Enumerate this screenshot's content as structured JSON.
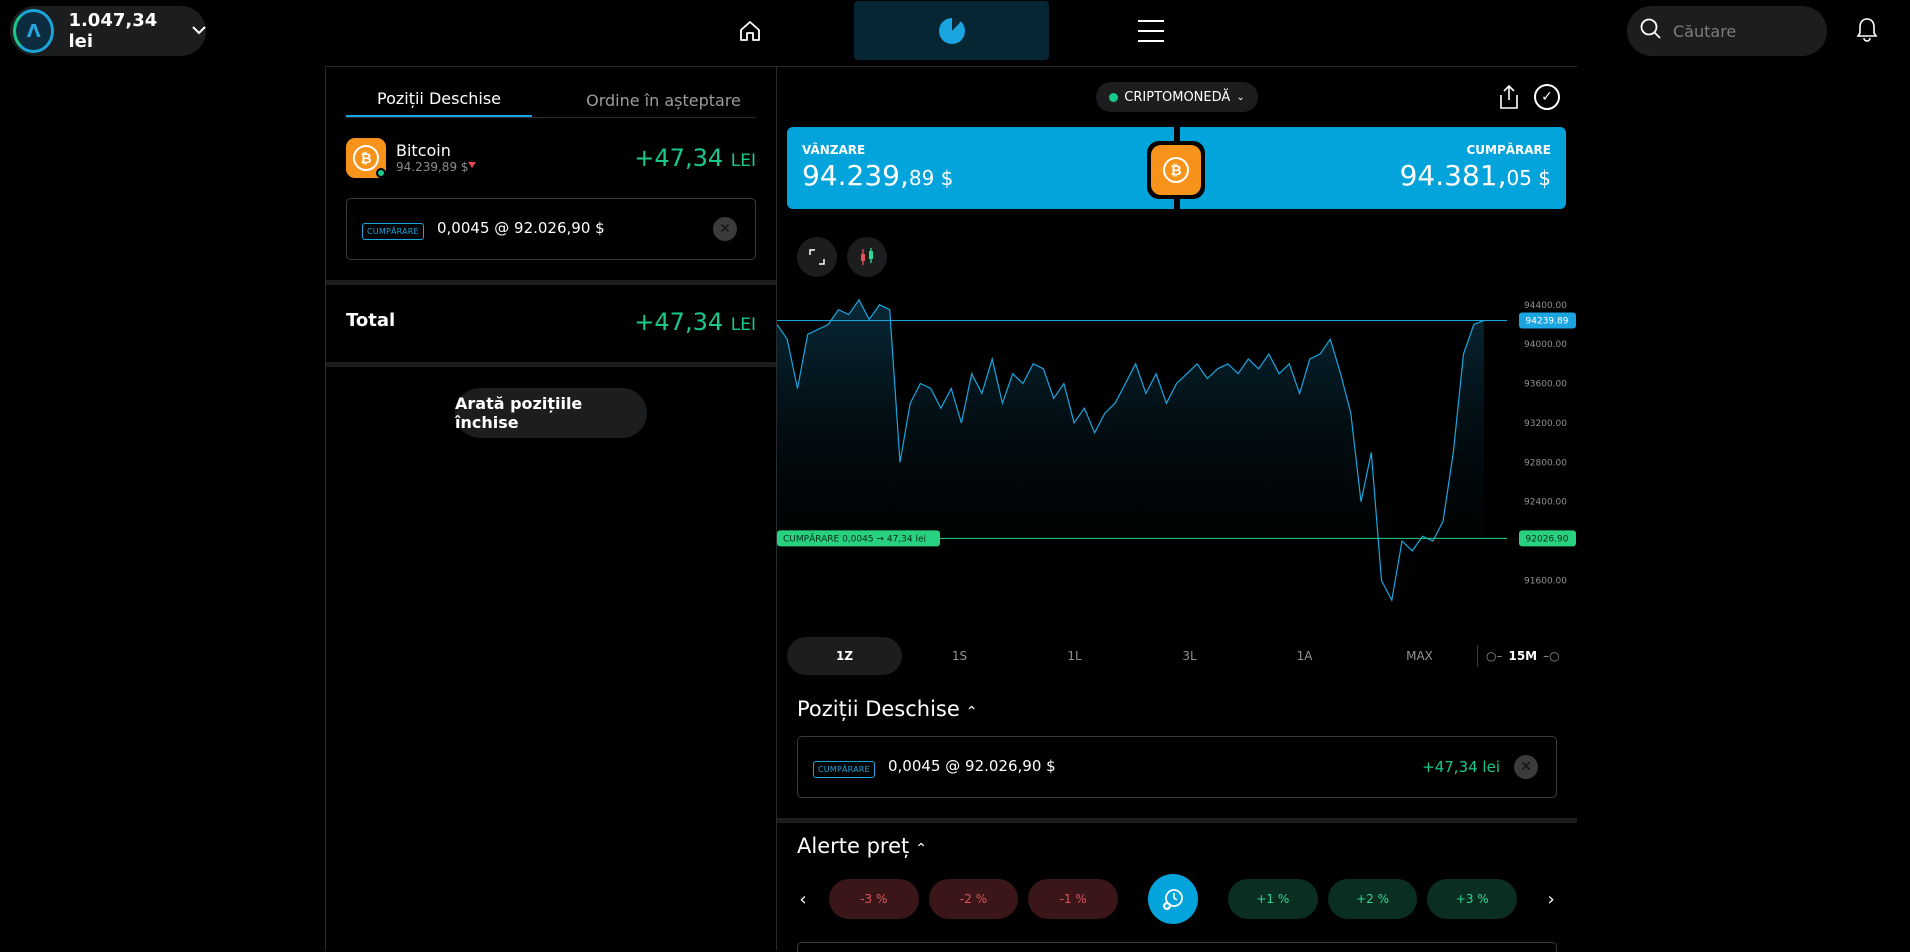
{
  "header": {
    "account_balance": "1.047,34 lei",
    "logo_letter": "Λ",
    "search_placeholder": "Căutare"
  },
  "left_panel": {
    "tabs": [
      {
        "label": "Poziții Deschise",
        "active": true
      },
      {
        "label": "Ordine în așteptare",
        "active": false
      }
    ],
    "asset": {
      "name": "Bitcoin",
      "price": "94.239,89 $",
      "pnl_main": "+47,34",
      "pnl_unit": "LEI"
    },
    "position": {
      "side": "CUMPĂRARE",
      "details": "0,0045 @ 92.026,90 $"
    },
    "total": {
      "label": "Total",
      "pnl_main": "+47,34",
      "pnl_unit": "LEI"
    },
    "show_closed_label": "Arată pozițiile închise"
  },
  "instrument": {
    "category": "CRIPTOMONEDĂ",
    "sell_label": "VÂNZARE",
    "sell_price_main": "94.239,",
    "sell_price_small": "89 $",
    "buy_label": "CUMPĂRARE",
    "buy_price_main": "94.381,",
    "buy_price_small": "05 $"
  },
  "chart_data": {
    "type": "line",
    "series": [
      {
        "values": [
          94200,
          94050,
          93550,
          94100,
          94150,
          94200,
          94350,
          94300,
          94450,
          94250,
          94400,
          94350,
          92800,
          93400,
          93600,
          93550,
          93350,
          93550,
          93200,
          93700,
          93500,
          93850,
          93400,
          93700,
          93600,
          93800,
          93750,
          93450,
          93600,
          93200,
          93350,
          93100,
          93300,
          93400,
          93600,
          93800,
          93500,
          93700,
          93400,
          93600,
          93700,
          93800,
          93650,
          93750,
          93800,
          93700,
          93850,
          93750,
          93900,
          93700,
          93800,
          93500,
          93850,
          93900,
          94050,
          93700,
          93300,
          92400,
          92900,
          91600,
          91400,
          92000,
          91900,
          92050,
          92000,
          92200,
          92900,
          93900,
          94200,
          94239.89
        ]
      }
    ],
    "y_ticks": [
      "94400.00",
      "94000.00",
      "93600.00",
      "93200.00",
      "92800.00",
      "92400.00",
      "91600.00"
    ],
    "ylim": [
      91300,
      94550
    ],
    "current_price_label": "94239.89",
    "entry_price_label": "92026.90",
    "entry_line_label": "CUMPĂRARE 0,0045 → 47,34 lei",
    "line_color": "#1aa5e0",
    "entry_color": "#27d17f"
  },
  "periods": {
    "items": [
      "1Z",
      "1S",
      "1L",
      "3L",
      "1A",
      "MAX"
    ],
    "active": "1Z",
    "interval": "15M"
  },
  "open_positions": {
    "title": "Poziții Deschise",
    "side": "CUMPĂRARE",
    "details": "0,0045 @ 92.026,90 $",
    "pnl": "+47,34 lei"
  },
  "price_alerts": {
    "title": "Alerte preț",
    "negative": [
      "-3 %",
      "-2 %",
      "-1 %"
    ],
    "positive": [
      "+1 %",
      "+2 %",
      "+3 %"
    ]
  },
  "colors": {
    "accent": "#03a3dc",
    "profit": "#19c98a",
    "loss": "#e0545a"
  }
}
